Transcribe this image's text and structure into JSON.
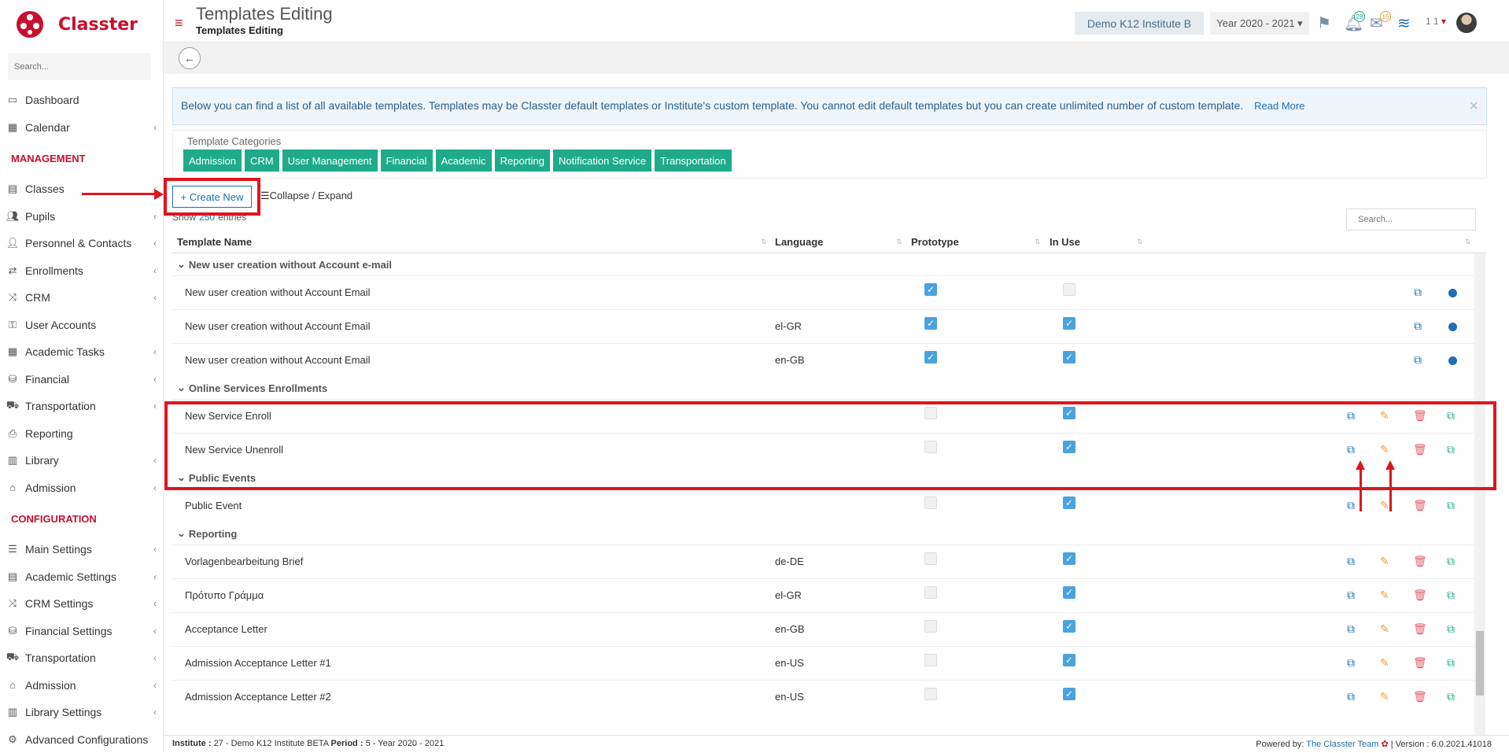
{
  "app": {
    "name": "Classter",
    "brand_color": "#c8102e",
    "accent": "#1fab8a"
  },
  "sidebar": {
    "search_placeholder": "Search...",
    "items": [
      {
        "label": "Dashboard",
        "icon": "monitor-icon"
      },
      {
        "label": "Calendar",
        "icon": "calendar-icon"
      }
    ],
    "management_header": "MANAGEMENT",
    "management": [
      {
        "label": "Classes",
        "icon": "classes-icon"
      },
      {
        "label": "Pupils",
        "icon": "users-icon"
      },
      {
        "label": "Personnel & Contacts",
        "icon": "person-icon"
      },
      {
        "label": "Enrollments",
        "icon": "exchange-icon"
      },
      {
        "label": "CRM",
        "icon": "random-icon"
      },
      {
        "label": "User Accounts",
        "icon": "key-icon"
      },
      {
        "label": "Academic Tasks",
        "icon": "grid-icon"
      },
      {
        "label": "Financial",
        "icon": "coins-icon"
      },
      {
        "label": "Transportation",
        "icon": "bus-icon"
      },
      {
        "label": "Reporting",
        "icon": "print-icon"
      },
      {
        "label": "Library",
        "icon": "books-icon"
      },
      {
        "label": "Admission",
        "icon": "bank-icon"
      }
    ],
    "config_header": "CONFIGURATION",
    "configuration": [
      {
        "label": "Main Settings",
        "icon": "sliders-icon"
      },
      {
        "label": "Academic Settings",
        "icon": "classes-icon"
      },
      {
        "label": "CRM Settings",
        "icon": "random-icon"
      },
      {
        "label": "Financial Settings",
        "icon": "coins-icon"
      },
      {
        "label": "Transportation",
        "icon": "bus-icon"
      },
      {
        "label": "Admission",
        "icon": "bank-icon"
      },
      {
        "label": "Library Settings",
        "icon": "books-icon"
      },
      {
        "label": "Advanced Configurations",
        "icon": "cogs-icon"
      }
    ]
  },
  "header": {
    "title": "Templates Editing",
    "subtitle": "Templates Editing",
    "institute": "Demo K12 Institute B",
    "year": "Year 2020 - 2021",
    "notifications_count": "28",
    "messages_count": "10",
    "user_count": "1 1"
  },
  "info": {
    "text": "Below you can find a list of all available templates. Templates may be Classter default templates or Institute's custom template. You cannot edit default templates but you can create unlimited number of custom template.",
    "read_more": "Read More"
  },
  "categories": {
    "label": "Template Categories",
    "items": [
      "Admission",
      "CRM",
      "User Management",
      "Financial",
      "Academic",
      "Reporting",
      "Notification Service",
      "Transportation"
    ]
  },
  "toolbar": {
    "create_label": "Create New",
    "collapse_label": "Collapse / Expand",
    "show_prefix": "Show",
    "show_count": "250",
    "show_suffix": "entries",
    "search_placeholder": "Search..."
  },
  "table": {
    "columns": [
      "Template Name",
      "Language",
      "Prototype",
      "In Use"
    ],
    "groups": [
      {
        "name": "New user creation without Account e-mail",
        "rows": [
          {
            "name": "New user creation without Account Email",
            "language": "",
            "prototype": true,
            "in_use": false,
            "actions": "prototype"
          },
          {
            "name": "New user creation without Account Email",
            "language": "el-GR",
            "prototype": true,
            "in_use": true,
            "actions": "prototype"
          },
          {
            "name": "New user creation without Account Email",
            "language": "en-GB",
            "prototype": true,
            "in_use": true,
            "actions": "prototype"
          }
        ]
      },
      {
        "name": "Online Services Enrollments",
        "rows": [
          {
            "name": "New Service Enroll",
            "language": "",
            "prototype": false,
            "in_use": true,
            "actions": "custom"
          },
          {
            "name": "New Service Unenroll",
            "language": "",
            "prototype": false,
            "in_use": true,
            "actions": "custom"
          }
        ]
      },
      {
        "name": "Public Events",
        "rows": [
          {
            "name": "Public Event",
            "language": "",
            "prototype": false,
            "in_use": true,
            "actions": "custom"
          }
        ]
      },
      {
        "name": "Reporting",
        "rows": [
          {
            "name": "Vorlagenbearbeitung Brief",
            "language": "de-DE",
            "prototype": false,
            "in_use": true,
            "actions": "custom"
          },
          {
            "name": "Πρότυπο Γράμμα",
            "language": "el-GR",
            "prototype": false,
            "in_use": true,
            "actions": "custom"
          },
          {
            "name": "Acceptance Letter",
            "language": "en-GB",
            "prototype": false,
            "in_use": true,
            "actions": "custom"
          },
          {
            "name": "Admission Acceptance Letter #1",
            "language": "en-US",
            "prototype": false,
            "in_use": true,
            "actions": "custom"
          },
          {
            "name": "Admission Acceptance Letter #2",
            "language": "en-US",
            "prototype": false,
            "in_use": true,
            "actions": "custom"
          }
        ]
      }
    ]
  },
  "footer": {
    "institute_label": "Institute :",
    "institute_value": "27 - Demo K12 Institute BETA",
    "period_label": "Period :",
    "period_value": "5 - Year 2020 - 2021",
    "powered_by": "Powered by:",
    "team": "The Classter Team",
    "version": "| Version : 6.0.2021.41018"
  }
}
